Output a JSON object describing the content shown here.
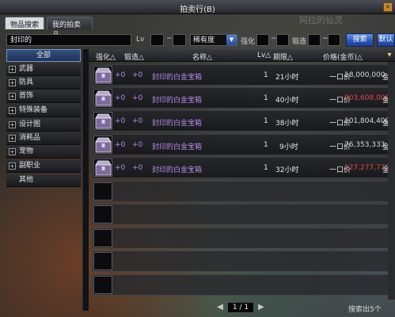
{
  "window": {
    "title": "拍卖行(B)",
    "watermark": "阿拉的仙灵"
  },
  "tabs": [
    {
      "label": "物品搜索",
      "active": true
    },
    {
      "label": "我的拍卖品",
      "active": false
    }
  ],
  "search": {
    "keyword": "封印的",
    "lv_label": "Lv",
    "tilde": "~",
    "rarity_label": "稀有度",
    "enhance_label": "强化",
    "forge_label": "锻造",
    "search_button": "搜索",
    "reset_button": "默认"
  },
  "categories": [
    {
      "label": "全部",
      "expandable": false,
      "active": true
    },
    {
      "label": "武器",
      "expandable": true,
      "active": false
    },
    {
      "label": "防具",
      "expandable": true,
      "active": false
    },
    {
      "label": "首饰",
      "expandable": true,
      "active": false
    },
    {
      "label": "特殊装备",
      "expandable": true,
      "active": false
    },
    {
      "label": "设计图",
      "expandable": true,
      "active": false
    },
    {
      "label": "消耗品",
      "expandable": true,
      "active": false
    },
    {
      "label": "宠物",
      "expandable": true,
      "active": false
    },
    {
      "label": "副职业",
      "expandable": true,
      "active": false
    },
    {
      "label": "其他",
      "expandable": false,
      "active": false
    }
  ],
  "columns": {
    "enhance": "强化△",
    "forge": "锻造△",
    "name": "名称△",
    "lv": "Lv△",
    "period": "期限△",
    "price": "价格(金币)△"
  },
  "rows": [
    {
      "enhance": "+0",
      "forge": "+0",
      "name": "封印的白金宝箱",
      "qty": "1",
      "period": "21小时",
      "type": "一口价",
      "price": "18,000,000",
      "unit": "金币",
      "price_color": "#d8d8d8"
    },
    {
      "enhance": "+0",
      "forge": "+0",
      "name": "封印的白金宝箱",
      "qty": "1",
      "period": "40小时",
      "type": "一口价",
      "price": "203,608,000",
      "unit": "金币",
      "price_color": "#e04848"
    },
    {
      "enhance": "+0",
      "forge": "+0",
      "name": "封印的白金宝箱",
      "qty": "1",
      "period": "38小时",
      "type": "一口价",
      "price": "101,804,400",
      "unit": "金币",
      "price_color": "#d8d8d8"
    },
    {
      "enhance": "+0",
      "forge": "+0",
      "name": "封印的白金宝箱",
      "qty": "1",
      "period": "9小时",
      "type": "一口价",
      "price": "76,353,333",
      "unit": "金币",
      "price_color": "#d8d8d8"
    },
    {
      "enhance": "+0",
      "forge": "+0",
      "name": "封印的白金宝箱",
      "qty": "1",
      "period": "32小时",
      "type": "一口价",
      "price": "127,277,775",
      "unit": "金币",
      "price_color": "#e04848"
    }
  ],
  "pager": {
    "page": "1 / 1",
    "prev": "◀",
    "next": "▶"
  },
  "footer": {
    "result_count": "搜索出5个"
  },
  "icons": {
    "item": "treasure-chest-icon",
    "sort": "sort-icon",
    "close": "close-icon"
  }
}
